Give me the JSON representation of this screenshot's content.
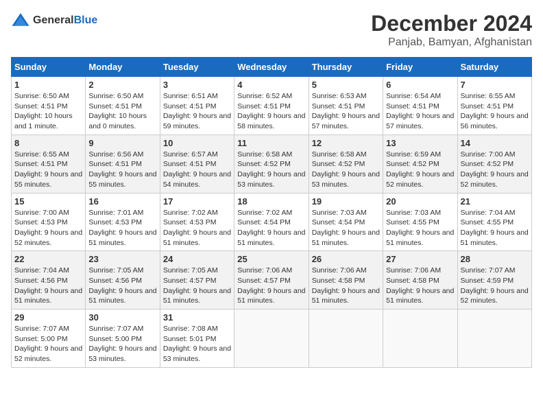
{
  "logo": {
    "general": "General",
    "blue": "Blue"
  },
  "title": "December 2024",
  "location": "Panjab, Bamyan, Afghanistan",
  "headers": [
    "Sunday",
    "Monday",
    "Tuesday",
    "Wednesday",
    "Thursday",
    "Friday",
    "Saturday"
  ],
  "weeks": [
    [
      {
        "day": "1",
        "sunrise": "6:50 AM",
        "sunset": "4:51 PM",
        "daylight": "Daylight: 10 hours and 1 minute."
      },
      {
        "day": "2",
        "sunrise": "6:50 AM",
        "sunset": "4:51 PM",
        "daylight": "Daylight: 10 hours and 0 minutes."
      },
      {
        "day": "3",
        "sunrise": "6:51 AM",
        "sunset": "4:51 PM",
        "daylight": "Daylight: 9 hours and 59 minutes."
      },
      {
        "day": "4",
        "sunrise": "6:52 AM",
        "sunset": "4:51 PM",
        "daylight": "Daylight: 9 hours and 58 minutes."
      },
      {
        "day": "5",
        "sunrise": "6:53 AM",
        "sunset": "4:51 PM",
        "daylight": "Daylight: 9 hours and 57 minutes."
      },
      {
        "day": "6",
        "sunrise": "6:54 AM",
        "sunset": "4:51 PM",
        "daylight": "Daylight: 9 hours and 57 minutes."
      },
      {
        "day": "7",
        "sunrise": "6:55 AM",
        "sunset": "4:51 PM",
        "daylight": "Daylight: 9 hours and 56 minutes."
      }
    ],
    [
      {
        "day": "8",
        "sunrise": "6:55 AM",
        "sunset": "4:51 PM",
        "daylight": "Daylight: 9 hours and 55 minutes."
      },
      {
        "day": "9",
        "sunrise": "6:56 AM",
        "sunset": "4:51 PM",
        "daylight": "Daylight: 9 hours and 55 minutes."
      },
      {
        "day": "10",
        "sunrise": "6:57 AM",
        "sunset": "4:51 PM",
        "daylight": "Daylight: 9 hours and 54 minutes."
      },
      {
        "day": "11",
        "sunrise": "6:58 AM",
        "sunset": "4:52 PM",
        "daylight": "Daylight: 9 hours and 53 minutes."
      },
      {
        "day": "12",
        "sunrise": "6:58 AM",
        "sunset": "4:52 PM",
        "daylight": "Daylight: 9 hours and 53 minutes."
      },
      {
        "day": "13",
        "sunrise": "6:59 AM",
        "sunset": "4:52 PM",
        "daylight": "Daylight: 9 hours and 52 minutes."
      },
      {
        "day": "14",
        "sunrise": "7:00 AM",
        "sunset": "4:52 PM",
        "daylight": "Daylight: 9 hours and 52 minutes."
      }
    ],
    [
      {
        "day": "15",
        "sunrise": "7:00 AM",
        "sunset": "4:53 PM",
        "daylight": "Daylight: 9 hours and 52 minutes."
      },
      {
        "day": "16",
        "sunrise": "7:01 AM",
        "sunset": "4:53 PM",
        "daylight": "Daylight: 9 hours and 51 minutes."
      },
      {
        "day": "17",
        "sunrise": "7:02 AM",
        "sunset": "4:53 PM",
        "daylight": "Daylight: 9 hours and 51 minutes."
      },
      {
        "day": "18",
        "sunrise": "7:02 AM",
        "sunset": "4:54 PM",
        "daylight": "Daylight: 9 hours and 51 minutes."
      },
      {
        "day": "19",
        "sunrise": "7:03 AM",
        "sunset": "4:54 PM",
        "daylight": "Daylight: 9 hours and 51 minutes."
      },
      {
        "day": "20",
        "sunrise": "7:03 AM",
        "sunset": "4:55 PM",
        "daylight": "Daylight: 9 hours and 51 minutes."
      },
      {
        "day": "21",
        "sunrise": "7:04 AM",
        "sunset": "4:55 PM",
        "daylight": "Daylight: 9 hours and 51 minutes."
      }
    ],
    [
      {
        "day": "22",
        "sunrise": "7:04 AM",
        "sunset": "4:56 PM",
        "daylight": "Daylight: 9 hours and 51 minutes."
      },
      {
        "day": "23",
        "sunrise": "7:05 AM",
        "sunset": "4:56 PM",
        "daylight": "Daylight: 9 hours and 51 minutes."
      },
      {
        "day": "24",
        "sunrise": "7:05 AM",
        "sunset": "4:57 PM",
        "daylight": "Daylight: 9 hours and 51 minutes."
      },
      {
        "day": "25",
        "sunrise": "7:06 AM",
        "sunset": "4:57 PM",
        "daylight": "Daylight: 9 hours and 51 minutes."
      },
      {
        "day": "26",
        "sunrise": "7:06 AM",
        "sunset": "4:58 PM",
        "daylight": "Daylight: 9 hours and 51 minutes."
      },
      {
        "day": "27",
        "sunrise": "7:06 AM",
        "sunset": "4:58 PM",
        "daylight": "Daylight: 9 hours and 51 minutes."
      },
      {
        "day": "28",
        "sunrise": "7:07 AM",
        "sunset": "4:59 PM",
        "daylight": "Daylight: 9 hours and 52 minutes."
      }
    ],
    [
      {
        "day": "29",
        "sunrise": "7:07 AM",
        "sunset": "5:00 PM",
        "daylight": "Daylight: 9 hours and 52 minutes."
      },
      {
        "day": "30",
        "sunrise": "7:07 AM",
        "sunset": "5:00 PM",
        "daylight": "Daylight: 9 hours and 53 minutes."
      },
      {
        "day": "31",
        "sunrise": "7:08 AM",
        "sunset": "5:01 PM",
        "daylight": "Daylight: 9 hours and 53 minutes."
      },
      null,
      null,
      null,
      null
    ]
  ]
}
